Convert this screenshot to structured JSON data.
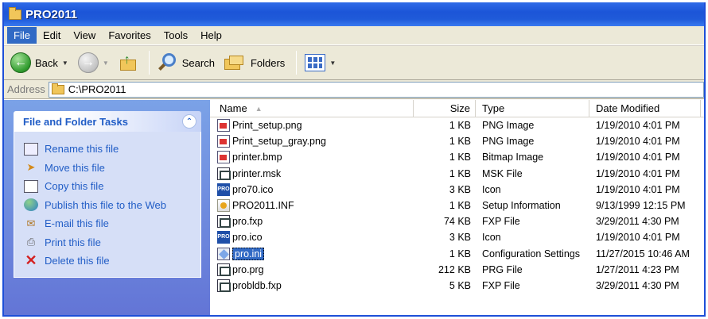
{
  "window": {
    "title": "PRO2011"
  },
  "menu": [
    "File",
    "Edit",
    "View",
    "Favorites",
    "Tools",
    "Help"
  ],
  "toolbar": {
    "back": "Back",
    "search": "Search",
    "folders": "Folders"
  },
  "address": {
    "label": "Address",
    "path": "C:\\PRO2011"
  },
  "tasks": {
    "title": "File and Folder Tasks",
    "items": [
      {
        "label": "Rename this file",
        "icon": "rename-icon"
      },
      {
        "label": "Move this file",
        "icon": "move-icon"
      },
      {
        "label": "Copy this file",
        "icon": "copy-icon"
      },
      {
        "label": "Publish this file to the Web",
        "icon": "publish-icon"
      },
      {
        "label": "E-mail this file",
        "icon": "email-icon"
      },
      {
        "label": "Print this file",
        "icon": "print-icon"
      },
      {
        "label": "Delete this file",
        "icon": "delete-icon"
      }
    ]
  },
  "columns": {
    "name": "Name",
    "size": "Size",
    "type": "Type",
    "date": "Date Modified"
  },
  "files": [
    {
      "name": "Print_setup.png",
      "size": "1 KB",
      "type": "PNG Image",
      "date": "1/19/2010 4:01 PM",
      "icon": "png-file-icon"
    },
    {
      "name": "Print_setup_gray.png",
      "size": "1 KB",
      "type": "PNG Image",
      "date": "1/19/2010 4:01 PM",
      "icon": "png-file-icon"
    },
    {
      "name": "printer.bmp",
      "size": "1 KB",
      "type": "Bitmap Image",
      "date": "1/19/2010 4:01 PM",
      "icon": "bmp-file-icon"
    },
    {
      "name": "printer.msk",
      "size": "1 KB",
      "type": "MSK File",
      "date": "1/19/2010 4:01 PM",
      "icon": "msk-file-icon"
    },
    {
      "name": "pro70.ico",
      "size": "3 KB",
      "type": "Icon",
      "date": "1/19/2010 4:01 PM",
      "icon": "ico-file-icon"
    },
    {
      "name": "PRO2011.INF",
      "size": "1 KB",
      "type": "Setup Information",
      "date": "9/13/1999 12:15 PM",
      "icon": "inf-file-icon"
    },
    {
      "name": "pro.fxp",
      "size": "74 KB",
      "type": "FXP File",
      "date": "3/29/2011 4:30 PM",
      "icon": "fxp-file-icon"
    },
    {
      "name": "pro.ico",
      "size": "3 KB",
      "type": "Icon",
      "date": "1/19/2010 4:01 PM",
      "icon": "ico-file-icon"
    },
    {
      "name": "pro.ini",
      "size": "1 KB",
      "type": "Configuration Settings",
      "date": "11/27/2015 10:46 AM",
      "icon": "ini-file-icon",
      "selected": true
    },
    {
      "name": "pro.prg",
      "size": "212 KB",
      "type": "PRG File",
      "date": "1/27/2011 4:23 PM",
      "icon": "prg-file-icon"
    },
    {
      "name": "probldb.fxp",
      "size": "5 KB",
      "type": "FXP File",
      "date": "3/29/2011 4:30 PM",
      "icon": "fxp-file-icon"
    }
  ],
  "colors": {
    "titlebar": "#1f5ad9",
    "selection": "#316ac5",
    "taskpane": "#7ba2e7",
    "task_link": "#215dc6"
  }
}
